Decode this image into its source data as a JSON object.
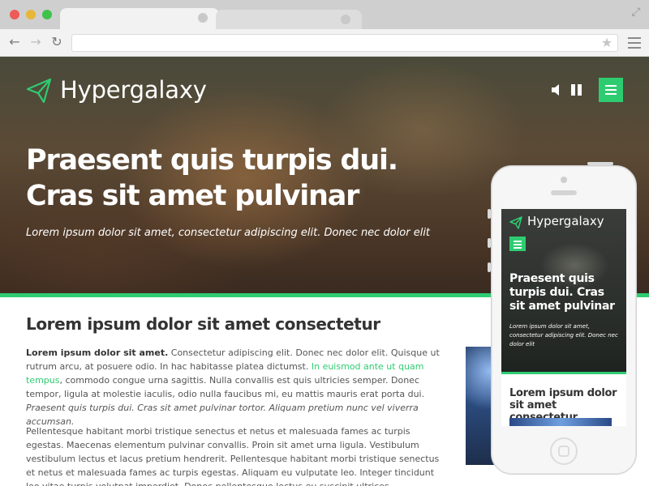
{
  "browser": {
    "url": "",
    "icons": {
      "back": "arrow-left-icon",
      "forward": "arrow-right-icon",
      "reload": "reload-icon",
      "star": "star-icon",
      "menu": "menu-icon",
      "expand": "expand-icon"
    }
  },
  "site": {
    "brand": "Hypergalaxy",
    "accent_color": "#2ecc71",
    "hero": {
      "title": "Praesent quis turpis dui. Cras sit amet pulvinar",
      "subtitle": "Lorem ipsum dolor sit amet, consectetur adipiscing elit. Donec nec dolor elit"
    },
    "content": {
      "title": "Lorem ipsum dolor sit amet consectetur",
      "p1_bold": "Lorem ipsum dolor sit amet.",
      "p1_text1": " Consectetur adipiscing elit. Donec nec dolor elit. Quisque ut rutrum arcu, at posuere odio. In hac habitasse platea dictumst. ",
      "p1_link": "In euismod ante ut quam tempus",
      "p1_text2": ", commodo congue urna sagittis. Nulla convallis est quis ultricies semper. Donec tempor, ligula at molestie iaculis, odio nulla faucibus mi, eu mattis mauris erat porta dui. ",
      "p1_italic": "Praesent quis turpis dui. Cras sit amet pulvinar tortor. Aliquam pretium nunc vel viverra accumsan.",
      "p2": "Pellentesque habitant morbi tristique senectus et netus et malesuada fames ac turpis egestas. Maecenas elementum pulvinar convallis. Proin sit amet urna ligula. Vestibulum vestibulum lectus et lacus pretium hendrerit. Pellentesque habitant morbi tristique senectus et netus et malesuada fames ac turpis egestas. Aliquam eu vulputate leo. Integer tincidunt leo vitae turpis volutpat imperdiet. Donec pellentesque lectus eu suscipit ultrices. Pellentesque a quam auctor, pulvinar lacus vel, euismod purus."
    }
  },
  "mobile": {
    "brand": "Hypergalaxy",
    "hero_title": "Praesent quis turpis dui. Cras sit amet pulvinar",
    "hero_subtitle": "Lorem ipsum dolor sit amet, consectetur adipiscing elit. Donec nec dolor elit",
    "content_title": "Lorem ipsum dolor sit amet consectetur"
  }
}
